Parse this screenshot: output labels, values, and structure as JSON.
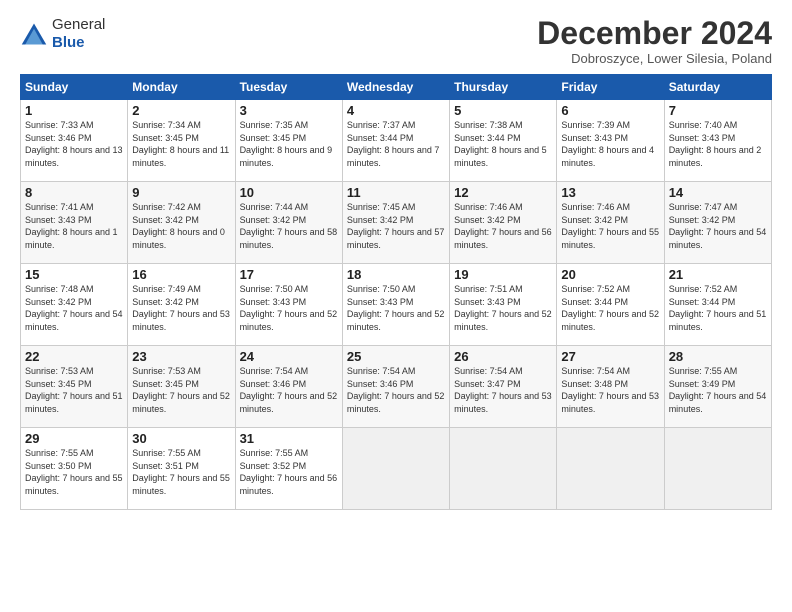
{
  "logo": {
    "line1": "General",
    "line2": "Blue"
  },
  "title": "December 2024",
  "subtitle": "Dobroszyce, Lower Silesia, Poland",
  "days_of_week": [
    "Sunday",
    "Monday",
    "Tuesday",
    "Wednesday",
    "Thursday",
    "Friday",
    "Saturday"
  ],
  "weeks": [
    [
      {
        "num": "1",
        "rise": "7:33 AM",
        "set": "3:46 PM",
        "daylight": "8 hours and 13 minutes."
      },
      {
        "num": "2",
        "rise": "7:34 AM",
        "set": "3:45 PM",
        "daylight": "8 hours and 11 minutes."
      },
      {
        "num": "3",
        "rise": "7:35 AM",
        "set": "3:45 PM",
        "daylight": "8 hours and 9 minutes."
      },
      {
        "num": "4",
        "rise": "7:37 AM",
        "set": "3:44 PM",
        "daylight": "8 hours and 7 minutes."
      },
      {
        "num": "5",
        "rise": "7:38 AM",
        "set": "3:44 PM",
        "daylight": "8 hours and 5 minutes."
      },
      {
        "num": "6",
        "rise": "7:39 AM",
        "set": "3:43 PM",
        "daylight": "8 hours and 4 minutes."
      },
      {
        "num": "7",
        "rise": "7:40 AM",
        "set": "3:43 PM",
        "daylight": "8 hours and 2 minutes."
      }
    ],
    [
      {
        "num": "8",
        "rise": "7:41 AM",
        "set": "3:43 PM",
        "daylight": "8 hours and 1 minute."
      },
      {
        "num": "9",
        "rise": "7:42 AM",
        "set": "3:42 PM",
        "daylight": "8 hours and 0 minutes."
      },
      {
        "num": "10",
        "rise": "7:44 AM",
        "set": "3:42 PM",
        "daylight": "7 hours and 58 minutes."
      },
      {
        "num": "11",
        "rise": "7:45 AM",
        "set": "3:42 PM",
        "daylight": "7 hours and 57 minutes."
      },
      {
        "num": "12",
        "rise": "7:46 AM",
        "set": "3:42 PM",
        "daylight": "7 hours and 56 minutes."
      },
      {
        "num": "13",
        "rise": "7:46 AM",
        "set": "3:42 PM",
        "daylight": "7 hours and 55 minutes."
      },
      {
        "num": "14",
        "rise": "7:47 AM",
        "set": "3:42 PM",
        "daylight": "7 hours and 54 minutes."
      }
    ],
    [
      {
        "num": "15",
        "rise": "7:48 AM",
        "set": "3:42 PM",
        "daylight": "7 hours and 54 minutes."
      },
      {
        "num": "16",
        "rise": "7:49 AM",
        "set": "3:42 PM",
        "daylight": "7 hours and 53 minutes."
      },
      {
        "num": "17",
        "rise": "7:50 AM",
        "set": "3:43 PM",
        "daylight": "7 hours and 52 minutes."
      },
      {
        "num": "18",
        "rise": "7:50 AM",
        "set": "3:43 PM",
        "daylight": "7 hours and 52 minutes."
      },
      {
        "num": "19",
        "rise": "7:51 AM",
        "set": "3:43 PM",
        "daylight": "7 hours and 52 minutes."
      },
      {
        "num": "20",
        "rise": "7:52 AM",
        "set": "3:44 PM",
        "daylight": "7 hours and 52 minutes."
      },
      {
        "num": "21",
        "rise": "7:52 AM",
        "set": "3:44 PM",
        "daylight": "7 hours and 51 minutes."
      }
    ],
    [
      {
        "num": "22",
        "rise": "7:53 AM",
        "set": "3:45 PM",
        "daylight": "7 hours and 51 minutes."
      },
      {
        "num": "23",
        "rise": "7:53 AM",
        "set": "3:45 PM",
        "daylight": "7 hours and 52 minutes."
      },
      {
        "num": "24",
        "rise": "7:54 AM",
        "set": "3:46 PM",
        "daylight": "7 hours and 52 minutes."
      },
      {
        "num": "25",
        "rise": "7:54 AM",
        "set": "3:46 PM",
        "daylight": "7 hours and 52 minutes."
      },
      {
        "num": "26",
        "rise": "7:54 AM",
        "set": "3:47 PM",
        "daylight": "7 hours and 53 minutes."
      },
      {
        "num": "27",
        "rise": "7:54 AM",
        "set": "3:48 PM",
        "daylight": "7 hours and 53 minutes."
      },
      {
        "num": "28",
        "rise": "7:55 AM",
        "set": "3:49 PM",
        "daylight": "7 hours and 54 minutes."
      }
    ],
    [
      {
        "num": "29",
        "rise": "7:55 AM",
        "set": "3:50 PM",
        "daylight": "7 hours and 55 minutes."
      },
      {
        "num": "30",
        "rise": "7:55 AM",
        "set": "3:51 PM",
        "daylight": "7 hours and 55 minutes."
      },
      {
        "num": "31",
        "rise": "7:55 AM",
        "set": "3:52 PM",
        "daylight": "7 hours and 56 minutes."
      },
      null,
      null,
      null,
      null
    ]
  ]
}
